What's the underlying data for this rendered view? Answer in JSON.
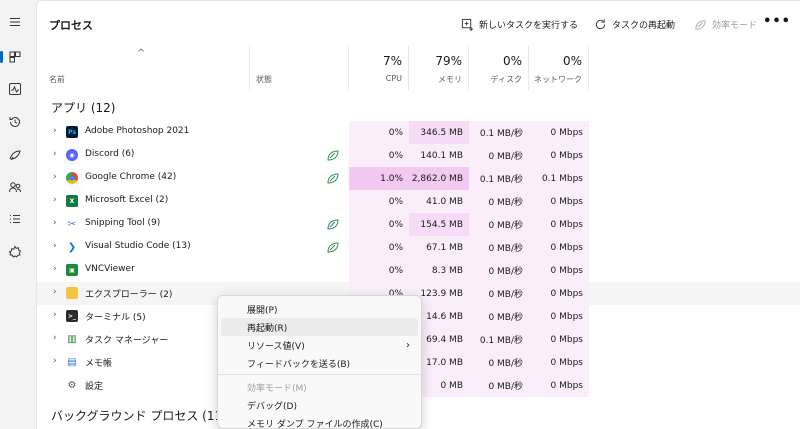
{
  "title": "プロセス",
  "toolbar": {
    "new_task": "新しいタスクを実行する",
    "restart": "タスクの再起動",
    "efficiency": "効率モード",
    "more": "•••"
  },
  "nav_icons": [
    "hamburger-icon",
    "processes-icon",
    "performance-icon",
    "app-history-icon",
    "startup-apps-icon",
    "users-icon",
    "details-icon",
    "services-icon"
  ],
  "columns": {
    "name": "名前",
    "status": "状態",
    "cpu": {
      "pct": "7%",
      "label": "CPU"
    },
    "memory": {
      "pct": "79%",
      "label": "メモリ"
    },
    "disk": {
      "pct": "0%",
      "label": "ディスク"
    },
    "network": {
      "pct": "0%",
      "label": "ネットワーク"
    }
  },
  "groups": {
    "apps": "アプリ (12)",
    "background": "バックグラウンド プロセス (111)"
  },
  "rows": [
    {
      "name": "Adobe Photoshop 2021",
      "icon": "photoshop-icon",
      "eco": false,
      "cpu": "0%",
      "mem": "346.5 MB",
      "disk": "0.1 MB/秒",
      "net": "0 Mbps"
    },
    {
      "name": "Discord (6)",
      "icon": "discord-icon",
      "eco": true,
      "cpu": "0%",
      "mem": "140.1 MB",
      "disk": "0 MB/秒",
      "net": "0 Mbps"
    },
    {
      "name": "Google Chrome (42)",
      "icon": "chrome-icon",
      "eco": true,
      "cpu": "1.0%",
      "mem": "2,862.0 MB",
      "disk": "0.1 MB/秒",
      "net": "0.1 Mbps"
    },
    {
      "name": "Microsoft Excel (2)",
      "icon": "excel-icon",
      "eco": false,
      "cpu": "0%",
      "mem": "41.0 MB",
      "disk": "0 MB/秒",
      "net": "0 Mbps"
    },
    {
      "name": "Snipping Tool (9)",
      "icon": "snipping-tool-icon",
      "eco": true,
      "cpu": "0%",
      "mem": "154.5 MB",
      "disk": "0 MB/秒",
      "net": "0 Mbps"
    },
    {
      "name": "Visual Studio Code (13)",
      "icon": "vscode-icon",
      "eco": true,
      "cpu": "0%",
      "mem": "67.1 MB",
      "disk": "0 MB/秒",
      "net": "0 Mbps"
    },
    {
      "name": "VNCViewer",
      "icon": "vncviewer-icon",
      "eco": false,
      "cpu": "0%",
      "mem": "8.3 MB",
      "disk": "0 MB/秒",
      "net": "0 Mbps"
    },
    {
      "name": "エクスプローラー (2)",
      "icon": "folder-icon",
      "eco": false,
      "cpu": "0%",
      "mem": "123.9 MB",
      "disk": "0 MB/秒",
      "net": "0 Mbps"
    },
    {
      "name": "ターミナル (5)",
      "icon": "terminal-icon",
      "eco": false,
      "cpu": "",
      "mem": "14.6 MB",
      "disk": "0 MB/秒",
      "net": "0 Mbps"
    },
    {
      "name": "タスク マネージャー",
      "icon": "task-manager-icon",
      "eco": false,
      "cpu": "",
      "mem": "69.4 MB",
      "disk": "0.1 MB/秒",
      "net": "0 Mbps"
    },
    {
      "name": "メモ帳",
      "icon": "notepad-icon",
      "eco": false,
      "cpu": "",
      "mem": "17.0 MB",
      "disk": "0 MB/秒",
      "net": "0 Mbps"
    },
    {
      "name": "設定",
      "icon": "settings-gear-icon",
      "eco": false,
      "cpu": "",
      "mem": "0 MB",
      "disk": "0 MB/秒",
      "net": "0 Mbps"
    }
  ],
  "context_menu": [
    {
      "label": "展開(P)",
      "state": "normal"
    },
    {
      "label": "再起動(R)",
      "state": "selected"
    },
    {
      "label": "リソース値(V)",
      "state": "normal",
      "submenu": "›"
    },
    {
      "label": "フィードバックを送る(B)",
      "state": "normal"
    },
    {
      "label": "効率モード(M)",
      "state": "disabled"
    },
    {
      "label": "デバッグ(D)",
      "state": "normal"
    },
    {
      "label": "メモリ ダンプ ファイルの作成(C)",
      "state": "normal"
    }
  ],
  "colors": {
    "accent": "#0067c0",
    "heat_light": "#fbeefb",
    "heat_mid": "#f6dcf6",
    "heat_strong": "#f1c9f1",
    "eco_green": "#2e8b57"
  }
}
